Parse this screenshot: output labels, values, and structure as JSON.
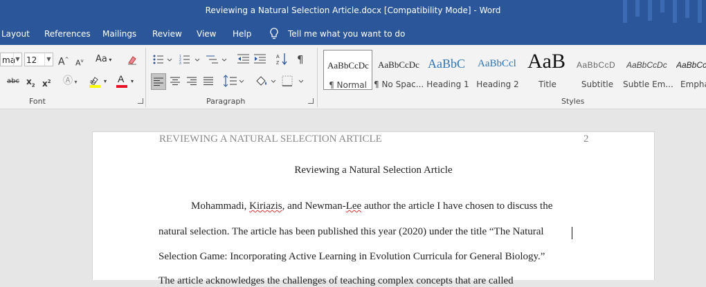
{
  "titlebar": {
    "title": "Reviewing a Natural Selection Article.docx [Compatibility Mode]  -  Word"
  },
  "tabs": [
    "Layout",
    "References",
    "Mailings",
    "Review",
    "View",
    "Help"
  ],
  "tell_me": "Tell me what you want to do",
  "font": {
    "name": "ma",
    "size": "12",
    "group_label": "Font",
    "grow_label": "A",
    "shrink_label": "A",
    "case_label": "Aa",
    "strike_label": "abc",
    "subscript_label": "x",
    "superscript_label": "x",
    "font_color_label": "A"
  },
  "paragraph": {
    "group_label": "Paragraph"
  },
  "styles": {
    "group_label": "Styles",
    "items": [
      {
        "preview": "AaBbCcDc",
        "name": "¶ Normal"
      },
      {
        "preview": "AaBbCcDc",
        "name": "¶ No Spac..."
      },
      {
        "preview": "AaBbC",
        "name": "Heading 1"
      },
      {
        "preview": "AaBbCcl",
        "name": "Heading 2"
      },
      {
        "preview": "AaB",
        "name": "Title"
      },
      {
        "preview": "AaBbCcD",
        "name": "Subtitle"
      },
      {
        "preview": "AaBbCcDc",
        "name": "Subtle Em..."
      },
      {
        "preview": "AaBbCcDc",
        "name": "Empha"
      }
    ]
  },
  "document": {
    "running_head": "REVIEWING A NATURAL SELECTION ARTICLE",
    "page_number": "2",
    "heading": "Reviewing a Natural Selection Article",
    "line1_a": "Mohammadi, ",
    "line1_b": "Kiriazis",
    "line1_c": ", and Newman-",
    "line1_d": "Lee",
    "line1_e": " author the article I have chosen to discuss the",
    "line2": "natural selection. The article has been published this year (2020) under the title “The Natural",
    "line3": "Selection Game: Incorporating Active Learning in Evolution Curricula for General Biology.”",
    "line4": "The article acknowledges the challenges of teaching complex concepts that are called"
  },
  "colors": {
    "accent": "#2b579a",
    "highlight": "#ffff00",
    "font_color": "#e81123"
  }
}
